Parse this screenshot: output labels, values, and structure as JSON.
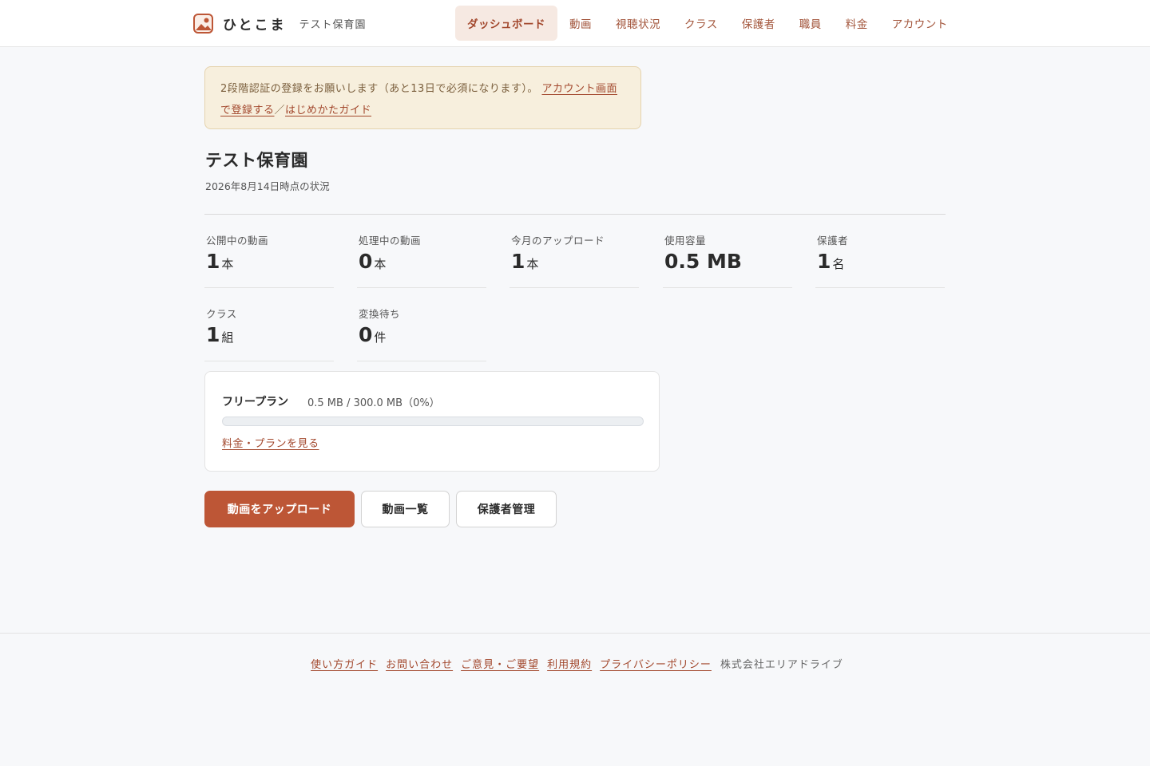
{
  "header": {
    "brand_name": "ひとこま",
    "school_name": "テスト保育園",
    "nav": [
      {
        "label": "ダッシュボード",
        "active": true
      },
      {
        "label": "動画",
        "active": false
      },
      {
        "label": "視聴状況",
        "active": false
      },
      {
        "label": "クラス",
        "active": false
      },
      {
        "label": "保護者",
        "active": false
      },
      {
        "label": "職員",
        "active": false
      },
      {
        "label": "料金",
        "active": false
      },
      {
        "label": "アカウント",
        "active": false
      }
    ]
  },
  "notice": {
    "text": "2段階認証の登録をお願いします（あと13日で必須になります）。",
    "link_account": "アカウント画面で登録する",
    "separator": "／",
    "link_guide": "はじめかたガイド"
  },
  "page": {
    "title": "テスト保育園",
    "subtitle": "2026年8月14日時点の状況"
  },
  "stats": [
    {
      "label": "公開中の動画",
      "value": "1",
      "unit": "本"
    },
    {
      "label": "処理中の動画",
      "value": "0",
      "unit": "本"
    },
    {
      "label": "今月のアップロード",
      "value": "1",
      "unit": "本"
    },
    {
      "label": "使用容量",
      "value": "0.5 MB",
      "unit": ""
    },
    {
      "label": "保護者",
      "value": "1",
      "unit": "名"
    },
    {
      "label": "クラス",
      "value": "1",
      "unit": "組"
    },
    {
      "label": "変換待ち",
      "value": "0",
      "unit": "件"
    }
  ],
  "plan": {
    "name": "フリープラン",
    "usage": "0.5 MB / 300.0 MB（0%）",
    "usage_percent": 0,
    "link": "料金・プランを見る"
  },
  "actions": {
    "upload": "動画をアップロード",
    "video_list": "動画一覧",
    "guardian_manage": "保護者管理"
  },
  "footer": {
    "links": [
      "使い方ガイド",
      "お問い合わせ",
      "ご意見・ご要望",
      "利用規約",
      "プライバシーポリシー"
    ],
    "company": "株式会社エリアドライブ"
  },
  "colors": {
    "accent": "#bd5636",
    "nav_active_bg": "#f6e9e2",
    "notice_bg": "#f7efdd"
  }
}
